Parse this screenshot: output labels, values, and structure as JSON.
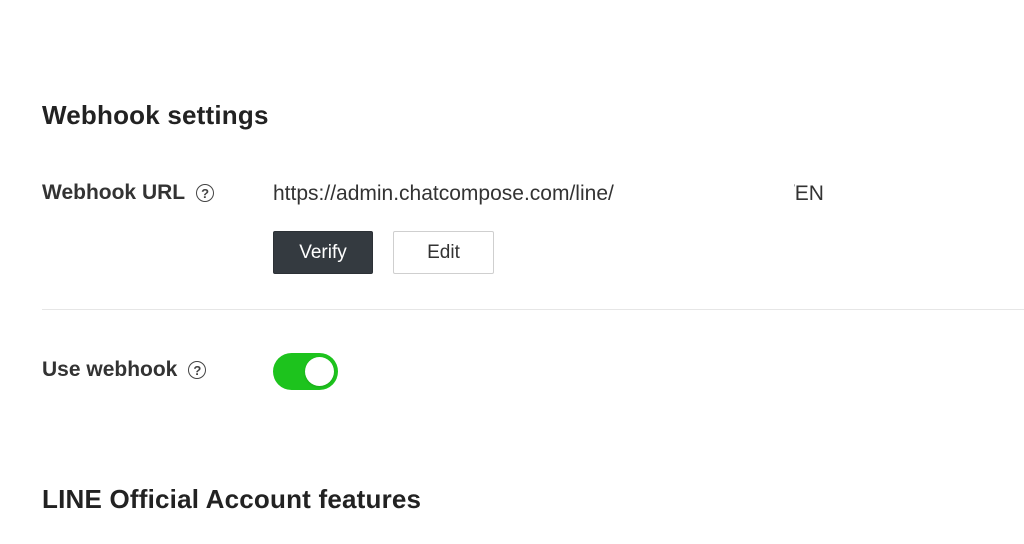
{
  "webhook_settings": {
    "title": "Webhook settings",
    "url_field": {
      "label": "Webhook URL",
      "help_icon": "?",
      "value": "https://admin.chatcompose.com/line/                              /EN"
    },
    "verify_label": "Verify",
    "edit_label": "Edit",
    "use_webhook": {
      "label": "Use webhook",
      "help_icon": "?",
      "enabled": true
    }
  },
  "features": {
    "title": "LINE Official Account features"
  },
  "colors": {
    "verify_bg": "#343a40",
    "toggle_on": "#1dc31d",
    "divider": "#e6e6e6"
  },
  "icons": {
    "help": "help-circle-icon"
  }
}
